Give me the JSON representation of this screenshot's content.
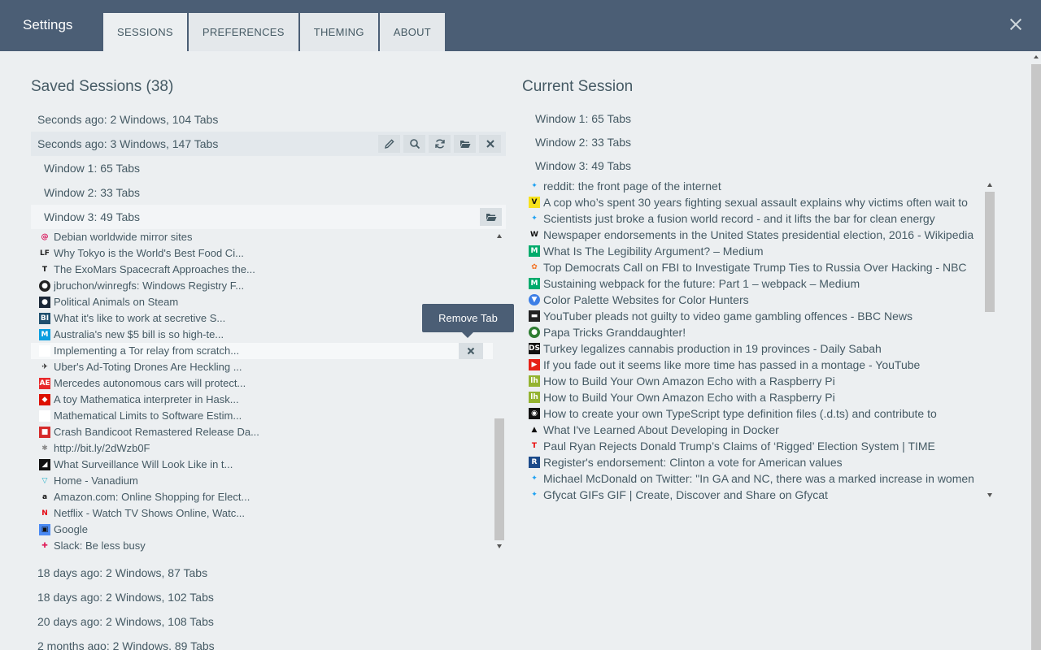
{
  "header": {
    "title": "Settings",
    "tabs": [
      {
        "label": "SESSIONS"
      },
      {
        "label": "PREFERENCES"
      },
      {
        "label": "THEMING"
      },
      {
        "label": "ABOUT"
      }
    ],
    "active_tab": "SESSIONS",
    "close_icon": "close-icon"
  },
  "saved": {
    "title": "Saved Sessions (38)",
    "sessions": [
      {
        "label": "Seconds ago: 2 Windows, 104 Tabs"
      },
      {
        "label": "Seconds ago: 3 Windows, 147 Tabs"
      },
      {
        "label": "18 days ago: 2 Windows, 87 Tabs"
      },
      {
        "label": "18 days ago: 2 Windows, 102 Tabs"
      },
      {
        "label": "20 days ago: 2 Windows, 108 Tabs"
      },
      {
        "label": "2 months ago: 2 Windows, 89 Tabs"
      }
    ],
    "windows": [
      {
        "label": "Window 1: 65 Tabs"
      },
      {
        "label": "Window 2: 33 Tabs"
      },
      {
        "label": "Window 3: 49 Tabs"
      }
    ],
    "tabs": [
      {
        "title": "Debian worldwide mirror sites",
        "icon": "debian-icon",
        "color": "#d70a53"
      },
      {
        "title": "Why Tokyo is the World's Best Food Ci...",
        "icon": "lf-icon",
        "color": "#222222"
      },
      {
        "title": "The ExoMars Spacecraft Approaches the...",
        "icon": "nyt-icon",
        "color": "#111111"
      },
      {
        "title": "jbruchon/winregfs: Windows Registry F...",
        "icon": "github-icon",
        "color": "#222222"
      },
      {
        "title": "Political Animals on Steam",
        "icon": "steam-icon",
        "color": "#1b2838"
      },
      {
        "title": "What it's like to work at secretive S...",
        "icon": "bi-icon",
        "color": "#1e4f6e"
      },
      {
        "title": "Australia's new $5 bill is so high-te...",
        "icon": "mashable-icon",
        "color": "#0a9ee0"
      },
      {
        "title": "Implementing a Tor relay from scratch...",
        "icon": "blank-icon",
        "color": "#ffffff"
      },
      {
        "title": "Uber's Ad-Toting Drones Are Heckling ...",
        "icon": "gizmodo-icon",
        "color": "#111111"
      },
      {
        "title": "Mercedes autonomous cars will protect...",
        "icon": "ae-icon",
        "color": "#e8282b"
      },
      {
        "title": "A toy Mathematica interpreter in Hask...",
        "icon": "mathematica-icon",
        "color": "#dd1100"
      },
      {
        "title": "Mathematical Limits to Software Estim...",
        "icon": "blank-icon",
        "color": "#ffffff"
      },
      {
        "title": "Crash Bandicoot Remastered Release Da...",
        "icon": "game-icon",
        "color": "#d62b2b"
      },
      {
        "title": "http://bit.ly/2dWzb0F",
        "icon": "bitly-icon",
        "color": "#888888"
      },
      {
        "title": "What Surveillance Will Look Like in t...",
        "icon": "backchannel-icon",
        "color": "#111111"
      },
      {
        "title": "Home - Vanadium",
        "icon": "vanadium-icon",
        "color": "#24b0c8"
      },
      {
        "title": "Amazon.com: Online Shopping for Elect...",
        "icon": "amazon-icon",
        "color": "#111111"
      },
      {
        "title": "Netflix - Watch TV Shows Online, Watc...",
        "icon": "netflix-icon",
        "color": "#e50914"
      },
      {
        "title": "Google",
        "icon": "google-icon",
        "color": "#4a8af4"
      },
      {
        "title": "Slack: Be less busy",
        "icon": "slack-icon",
        "color": "#e01e5a"
      }
    ],
    "tooltip": "Remove Tab"
  },
  "current": {
    "title": "Current Session",
    "windows": [
      {
        "label": "Window 1: 65 Tabs"
      },
      {
        "label": "Window 2: 33 Tabs"
      },
      {
        "label": "Window 3: 49 Tabs"
      }
    ],
    "tabs": [
      {
        "title": "reddit: the front page of the internet",
        "icon": "twitter-icon",
        "color": "#1da1f2"
      },
      {
        "title": "A cop who’s spent 30 years fighting sexual assault explains why victims often wait to",
        "icon": "vox-icon",
        "color": "#f7e21b"
      },
      {
        "title": "Scientists just broke a fusion world record - and it lifts the bar for clean energy",
        "icon": "twitter-icon",
        "color": "#1da1f2"
      },
      {
        "title": "Newspaper endorsements in the United States presidential election, 2016 - Wikipedia",
        "icon": "wikipedia-icon",
        "color": "#ffffff"
      },
      {
        "title": "What Is The Legibility Argument? – Medium",
        "icon": "medium-icon",
        "color": "#00ab6c"
      },
      {
        "title": "Top Democrats Call on FBI to Investigate Trump Ties to Russia Over Hacking - NBC",
        "icon": "nbc-icon",
        "color": "#f37021"
      },
      {
        "title": "Sustaining webpack for the future: Part 1 – webpack – Medium",
        "icon": "medium-icon",
        "color": "#00ab6c"
      },
      {
        "title": "Color Palette Websites for Color Hunters",
        "icon": "palette-icon",
        "color": "#3d7fe6"
      },
      {
        "title": "YouTuber pleads not guilty to video game gambling offences - BBC News",
        "icon": "bbc-icon",
        "color": "#222222"
      },
      {
        "title": "Papa Tricks Granddaughter!",
        "icon": "green-dot-icon",
        "color": "#2e7d32"
      },
      {
        "title": "Turkey legalizes cannabis production in 19 provinces - Daily Sabah",
        "icon": "ds-icon",
        "color": "#111111"
      },
      {
        "title": "If you fade out it seems like more time has passed in a montage - YouTube",
        "icon": "youtube-icon",
        "color": "#e62117"
      },
      {
        "title": "How to Build Your Own Amazon Echo with a Raspberry Pi",
        "icon": "lifehacker-icon",
        "color": "#94b330"
      },
      {
        "title": "How to Build Your Own Amazon Echo with a Raspberry Pi",
        "icon": "lifehacker-icon",
        "color": "#94b330"
      },
      {
        "title": "How to create your own TypeScript type definition files (.d.ts) and contribute to",
        "icon": "circle-icon",
        "color": "#111111"
      },
      {
        "title": "What I've Learned About Developing in Docker",
        "icon": "hat-icon",
        "color": "#111111"
      },
      {
        "title": "Paul Ryan Rejects Donald Trump’s Claims of ‘Rigged’ Election System | TIME",
        "icon": "time-icon",
        "color": "#e90606"
      },
      {
        "title": "Register's endorsement: Clinton a vote for American values",
        "icon": "register-icon",
        "color": "#1b4a8a"
      },
      {
        "title": "Michael McDonald on Twitter: \"In GA and NC, there was a marked increase in women",
        "icon": "twitter-icon",
        "color": "#1da1f2"
      },
      {
        "title": "Gfycat GIFs GIF | Create, Discover and Share on Gfycat",
        "icon": "twitter-icon",
        "color": "#1da1f2"
      }
    ]
  },
  "colors": {
    "header_bg": "#4b5e75",
    "page_bg": "#eceff1",
    "text": "#455a64"
  }
}
